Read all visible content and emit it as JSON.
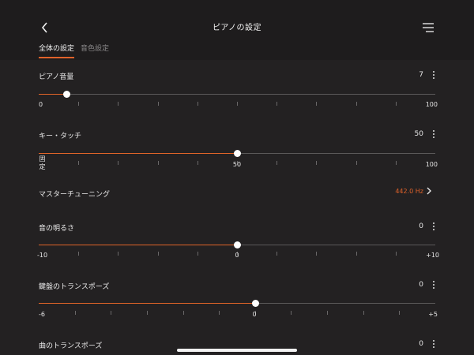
{
  "header": {
    "title": "ピアノの設定",
    "back_icon": "chevron-left-icon",
    "menu_icon": "menu-icon"
  },
  "tabs": [
    {
      "label": "全体の設定",
      "active": true
    },
    {
      "label": "音色設定",
      "active": false
    }
  ],
  "settings": {
    "piano_volume": {
      "label": "ピアノ音量",
      "value": "7",
      "min_label": "0",
      "max_label": "100",
      "fraction": 0.07
    },
    "key_touch": {
      "label": "キー・タッチ",
      "value": "50",
      "min_label": "固定",
      "mid_label": "50",
      "max_label": "100",
      "fraction": 0.5
    },
    "master_tuning": {
      "label": "マスターチューニング",
      "value": "442.0 Hz"
    },
    "brightness": {
      "label": "音の明るさ",
      "value": "0",
      "min_label": "-10",
      "mid_label": "0",
      "max_label": "+10",
      "fraction": 0.5
    },
    "key_transpose": {
      "label": "鍵盤のトランスポーズ",
      "value": "0",
      "min_label": "-6",
      "mid_label": "0",
      "max_label": "+5",
      "fraction": 0.545
    },
    "song_transpose": {
      "label": "曲のトランスポーズ",
      "value": "0"
    }
  },
  "colors": {
    "accent": "#e0622a",
    "background": "#232122",
    "header": "#1e1c1d"
  }
}
